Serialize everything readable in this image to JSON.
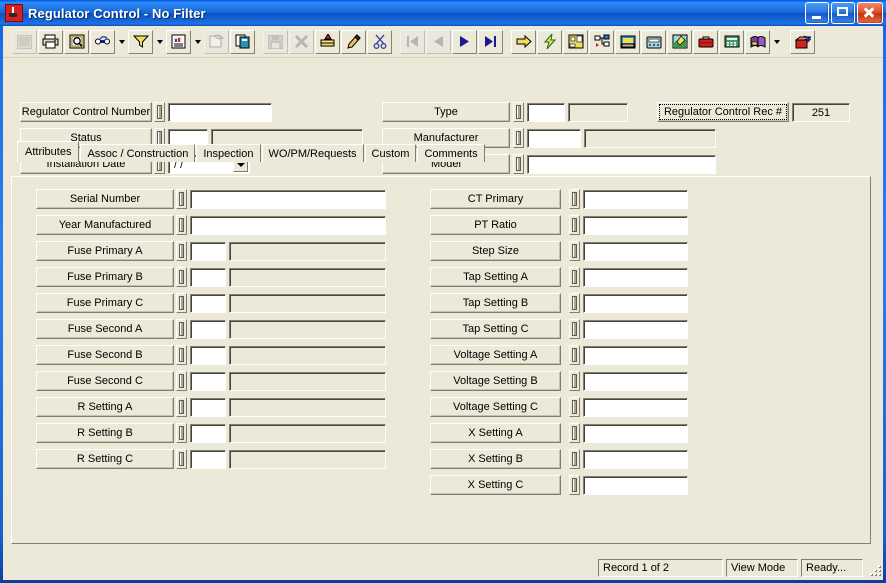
{
  "window": {
    "title": "Regulator Control - No Filter",
    "icon": "pin-icon",
    "minimize_label": "Minimize",
    "maximize_label": "Maximize",
    "close_label": "Close"
  },
  "toolbar": {
    "buttons": [
      {
        "name": "grid-view-icon",
        "title": "Grid View",
        "enabled": false
      },
      {
        "name": "print-icon",
        "title": "Print",
        "enabled": true
      },
      {
        "name": "print-preview-icon",
        "title": "Print Preview",
        "enabled": true
      },
      {
        "name": "find-icon",
        "title": "Find",
        "enabled": true,
        "dropdown": true
      },
      {
        "name": "filter-icon",
        "title": "Filter",
        "enabled": true,
        "dropdown": true
      },
      {
        "name": "report-icon",
        "title": "Report",
        "enabled": true,
        "dropdown": true
      },
      {
        "name": "properties-icon",
        "title": "Properties",
        "enabled": false
      },
      {
        "name": "copy-record-icon",
        "title": "Copy Record",
        "enabled": true
      },
      {
        "name": "save-icon",
        "title": "Save",
        "enabled": false
      },
      {
        "name": "delete-icon",
        "title": "Delete",
        "enabled": false
      },
      {
        "name": "add-record-icon",
        "title": "Add Record",
        "enabled": true
      },
      {
        "name": "edit-icon",
        "title": "Edit",
        "enabled": true
      },
      {
        "name": "cut-icon",
        "title": "Cut",
        "enabled": true
      },
      {
        "name": "first-record-icon",
        "title": "First Record",
        "enabled": false
      },
      {
        "name": "previous-record-icon",
        "title": "Previous Record",
        "enabled": false
      },
      {
        "name": "next-record-icon",
        "title": "Next Record",
        "enabled": true
      },
      {
        "name": "last-record-icon",
        "title": "Last Record",
        "enabled": true
      },
      {
        "name": "goto-icon",
        "title": "Go To",
        "enabled": true
      },
      {
        "name": "lightning-icon",
        "title": "Quick Action",
        "enabled": true
      },
      {
        "name": "map-icon",
        "title": "Map",
        "enabled": true
      },
      {
        "name": "tree-icon",
        "title": "Tree View",
        "enabled": true
      },
      {
        "name": "picture-icon",
        "title": "Picture",
        "enabled": true
      },
      {
        "name": "phone-icon",
        "title": "Phone",
        "enabled": true
      },
      {
        "name": "drawing-icon",
        "title": "Drawing",
        "enabled": true
      },
      {
        "name": "toolbox-icon",
        "title": "Tools",
        "enabled": true
      },
      {
        "name": "calculator-icon",
        "title": "Calculator",
        "enabled": true
      },
      {
        "name": "help-book-icon",
        "title": "Help",
        "enabled": true,
        "dropdown": true
      },
      {
        "name": "exit-icon",
        "title": "Exit",
        "enabled": true
      }
    ]
  },
  "header": {
    "left_fields": [
      {
        "label": "Regulator Control Number",
        "value": "",
        "second_value": null
      },
      {
        "label": "Status",
        "value": "",
        "second_value": ""
      },
      {
        "label": "Installation Date",
        "value": "/  /",
        "type": "date-combo"
      }
    ],
    "right_fields": [
      {
        "label": "Type",
        "value": "",
        "second_value": ""
      },
      {
        "label": "Manufacturer",
        "value": "",
        "second_value": ""
      },
      {
        "label": "Model",
        "value": "",
        "second_value": null
      }
    ],
    "record_button_label": "Regulator Control Rec #",
    "record_number": "251"
  },
  "tabs": [
    {
      "label": "Attributes",
      "active": true
    },
    {
      "label": "Assoc / Construction",
      "active": false
    },
    {
      "label": "Inspection",
      "active": false
    },
    {
      "label": "WO/PM/Requests",
      "active": false
    },
    {
      "label": "Custom",
      "active": false
    },
    {
      "label": "Comments",
      "active": false
    }
  ],
  "attributes": {
    "left_column": [
      {
        "label": "Serial Number",
        "value": "",
        "wide": true
      },
      {
        "label": "Year Manufactured",
        "value": "",
        "wide": true
      },
      {
        "label": "Fuse Primary A",
        "value": "",
        "second_value": ""
      },
      {
        "label": "Fuse Primary B",
        "value": "",
        "second_value": ""
      },
      {
        "label": "Fuse Primary C",
        "value": "",
        "second_value": ""
      },
      {
        "label": "Fuse Second A",
        "value": "",
        "second_value": ""
      },
      {
        "label": "Fuse Second B",
        "value": "",
        "second_value": ""
      },
      {
        "label": "Fuse Second C",
        "value": "",
        "second_value": ""
      },
      {
        "label": "R Setting A",
        "value": "",
        "second_value": ""
      },
      {
        "label": "R Setting B",
        "value": "",
        "second_value": ""
      },
      {
        "label": "R Setting C",
        "value": "",
        "second_value": ""
      }
    ],
    "right_column": [
      {
        "label": "CT Primary",
        "value": ""
      },
      {
        "label": "PT Ratio",
        "value": ""
      },
      {
        "label": "Step Size",
        "value": ""
      },
      {
        "label": "Tap Setting A",
        "value": ""
      },
      {
        "label": "Tap Setting B",
        "value": ""
      },
      {
        "label": "Tap Setting C",
        "value": ""
      },
      {
        "label": "Voltage Setting A",
        "value": ""
      },
      {
        "label": "Voltage Setting B",
        "value": ""
      },
      {
        "label": "Voltage Setting C",
        "value": ""
      },
      {
        "label": "X Setting A",
        "value": ""
      },
      {
        "label": "X Setting B",
        "value": ""
      },
      {
        "label": "X Setting C",
        "value": ""
      }
    ]
  },
  "statusbar": {
    "record_position": "Record 1 of 2",
    "mode": "View Mode",
    "state": "Ready..."
  },
  "colors": {
    "titlebar_blue": "#0a5ad8",
    "face": "#ece9d8",
    "shadow": "#808076",
    "highlight": "#ffffff",
    "field_white": "#ffffff",
    "close_red": "#c0340f"
  }
}
